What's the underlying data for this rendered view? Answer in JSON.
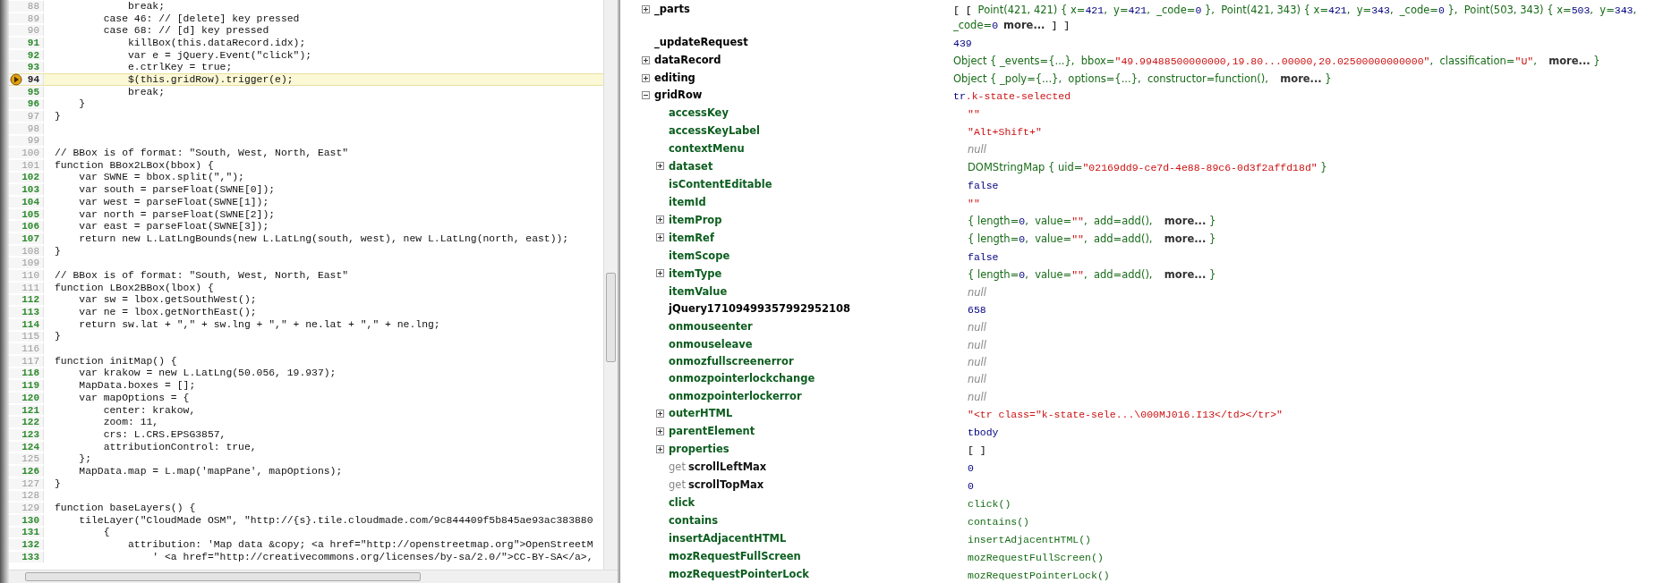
{
  "source": {
    "lines": [
      {
        "number": "88",
        "code": "            break;",
        "executable": false,
        "current": false
      },
      {
        "number": "89",
        "code": "        case 46: // [delete] key pressed",
        "executable": false,
        "current": false
      },
      {
        "number": "90",
        "code": "        case 68: // [d] key pressed",
        "executable": false,
        "current": false
      },
      {
        "number": "91",
        "code": "            killBox(this.dataRecord.idx);",
        "executable": true,
        "current": false
      },
      {
        "number": "92",
        "code": "            var e = jQuery.Event(\"click\");",
        "executable": true,
        "current": false
      },
      {
        "number": "93",
        "code": "            e.ctrlKey = true;",
        "executable": true,
        "current": false
      },
      {
        "number": "94",
        "code": "            $(this.gridRow).trigger(e);",
        "executable": true,
        "current": true
      },
      {
        "number": "95",
        "code": "            break;",
        "executable": true,
        "current": false
      },
      {
        "number": "96",
        "code": "    }",
        "executable": true,
        "current": false
      },
      {
        "number": "97",
        "code": "}",
        "executable": false,
        "current": false
      },
      {
        "number": "98",
        "executable": false,
        "current": false
      },
      {
        "number": "99",
        "executable": false,
        "current": false
      },
      {
        "number": "100",
        "code": "// BBox is of format: \"South, West, North, East\"",
        "executable": false,
        "current": false
      },
      {
        "number": "101",
        "code": "function BBox2LBox(bbox) {",
        "executable": false,
        "current": false
      },
      {
        "number": "102",
        "code": "    var SWNE = bbox.split(\",\");",
        "executable": true,
        "current": false
      },
      {
        "number": "103",
        "code": "    var south = parseFloat(SWNE[0]);",
        "executable": true,
        "current": false
      },
      {
        "number": "104",
        "code": "    var west = parseFloat(SWNE[1]);",
        "executable": true,
        "current": false
      },
      {
        "number": "105",
        "code": "    var north = parseFloat(SWNE[2]);",
        "executable": true,
        "current": false
      },
      {
        "number": "106",
        "code": "    var east = parseFloat(SWNE[3]);",
        "executable": true,
        "current": false
      },
      {
        "number": "107",
        "code": "    return new L.LatLngBounds(new L.LatLng(south, west), new L.LatLng(north, east));",
        "executable": true,
        "current": false
      },
      {
        "number": "108",
        "code": "}",
        "executable": false,
        "current": false
      },
      {
        "number": "109",
        "executable": false,
        "current": false
      },
      {
        "number": "110",
        "code": "// BBox is of format: \"South, West, North, East\"",
        "executable": false,
        "current": false
      },
      {
        "number": "111",
        "code": "function LBox2BBox(lbox) {",
        "executable": false,
        "current": false
      },
      {
        "number": "112",
        "code": "    var sw = lbox.getSouthWest();",
        "executable": true,
        "current": false
      },
      {
        "number": "113",
        "code": "    var ne = lbox.getNorthEast();",
        "executable": true,
        "current": false
      },
      {
        "number": "114",
        "code": "    return sw.lat + \",\" + sw.lng + \",\" + ne.lat + \",\" + ne.lng;",
        "executable": true,
        "current": false
      },
      {
        "number": "115",
        "code": "}",
        "executable": false,
        "current": false
      },
      {
        "number": "116",
        "executable": false,
        "current": false
      },
      {
        "number": "117",
        "code": "function initMap() {",
        "executable": false,
        "current": false
      },
      {
        "number": "118",
        "code": "    var krakow = new L.LatLng(50.056, 19.937);",
        "executable": true,
        "current": false
      },
      {
        "number": "119",
        "code": "    MapData.boxes = [];",
        "executable": true,
        "current": false
      },
      {
        "number": "120",
        "code": "    var mapOptions = {",
        "executable": true,
        "current": false
      },
      {
        "number": "121",
        "code": "        center: krakow,",
        "executable": true,
        "current": false
      },
      {
        "number": "122",
        "code": "        zoom: 11,",
        "executable": true,
        "current": false
      },
      {
        "number": "123",
        "code": "        crs: L.CRS.EPSG3857,",
        "executable": true,
        "current": false
      },
      {
        "number": "124",
        "code": "        attributionControl: true,",
        "executable": true,
        "current": false
      },
      {
        "number": "125",
        "code": "    };",
        "executable": false,
        "current": false
      },
      {
        "number": "126",
        "code": "    MapData.map = L.map('mapPane', mapOptions);",
        "executable": true,
        "current": false
      },
      {
        "number": "127",
        "code": "}",
        "executable": false,
        "current": false
      },
      {
        "number": "128",
        "executable": false,
        "current": false
      },
      {
        "number": "129",
        "code": "function baseLayers() {",
        "executable": false,
        "current": false
      },
      {
        "number": "130",
        "code": "    tileLayer(\"CloudMade OSM\", \"http://{s}.tile.cloudmade.com/9c844409f5b845ae93ac383880",
        "executable": true,
        "current": false
      },
      {
        "number": "131",
        "code": "        {",
        "executable": true,
        "current": false
      },
      {
        "number": "132",
        "code": "            attribution: 'Map data &copy; <a href=\"http://openstreetmap.org\">OpenStreetM",
        "executable": true,
        "current": false
      },
      {
        "number": "133",
        "code": "                ' <a href=\"http://creativecommons.org/licenses/by-sa/2.0/\">CC-BY-SA</a>,",
        "executable": true,
        "current": false
      }
    ]
  },
  "watch": {
    "rows": [
      {
        "name": "_parts",
        "kind": "user",
        "expanded": false,
        "value": [
          {
            "kind": "plain",
            "text": "[ [ "
          },
          {
            "kind": "obj",
            "text": "Point(421, 421) { x="
          },
          {
            "kind": "num",
            "text": "421"
          },
          {
            "kind": "obj",
            "text": ",  y="
          },
          {
            "kind": "num",
            "text": "421"
          },
          {
            "kind": "obj",
            "text": ",  _code="
          },
          {
            "kind": "num",
            "text": "0"
          },
          {
            "kind": "obj",
            "text": " },  Point(421, 343) { x="
          },
          {
            "kind": "num",
            "text": "421"
          },
          {
            "kind": "obj",
            "text": ",  y="
          },
          {
            "kind": "num",
            "text": "343"
          },
          {
            "kind": "obj",
            "text": ",  _code="
          },
          {
            "kind": "num",
            "text": "0"
          },
          {
            "kind": "obj",
            "text": " },  Point(503, 343) { x="
          },
          {
            "kind": "num",
            "text": "503"
          },
          {
            "kind": "obj",
            "text": ",  y="
          },
          {
            "kind": "num",
            "text": "343"
          },
          {
            "kind": "obj",
            "text": ",  _code="
          },
          {
            "kind": "num",
            "text": "0"
          },
          {
            "kind": "more",
            "text": "more..."
          },
          {
            "kind": "plain",
            "text": " ] ]"
          }
        ]
      },
      {
        "name": "_updateRequest",
        "kind": "user",
        "value": [
          {
            "kind": "num",
            "text": "439"
          }
        ]
      },
      {
        "name": "dataRecord",
        "kind": "user",
        "expanded": false,
        "value": [
          {
            "kind": "obj",
            "text": "Object { _events={...},  bbox="
          },
          {
            "kind": "str",
            "text": "\"49.99488500000000,19.80...00000,20.02500000000000\""
          },
          {
            "kind": "obj",
            "text": ",  classification="
          },
          {
            "kind": "str",
            "text": "\"U\""
          },
          {
            "kind": "obj",
            "text": ",  "
          },
          {
            "kind": "more",
            "text": "more..."
          },
          {
            "kind": "obj",
            "text": " }"
          }
        ]
      },
      {
        "name": "editing",
        "kind": "user",
        "expanded": false,
        "value": [
          {
            "kind": "obj",
            "text": "Object { _poly={...},  options={...},  constructor=function(),  "
          },
          {
            "kind": "more",
            "text": "more..."
          },
          {
            "kind": "obj",
            "text": " }"
          }
        ]
      },
      {
        "name": "gridRow",
        "kind": "user",
        "expanded": true,
        "value": [
          {
            "kind": "tag",
            "text": "tr"
          },
          {
            "kind": "str",
            "text": ".k-state-selected"
          }
        ],
        "children": [
          {
            "name": "accessKey",
            "kind": "dom",
            "value": [
              {
                "kind": "str",
                "text": "\"\""
              }
            ]
          },
          {
            "name": "accessKeyLabel",
            "kind": "dom",
            "value": [
              {
                "kind": "str",
                "text": "\"Alt+Shift+\""
              }
            ]
          },
          {
            "name": "contextMenu",
            "kind": "dom",
            "value": [
              {
                "kind": "null",
                "text": "null"
              }
            ]
          },
          {
            "name": "dataset",
            "kind": "dom",
            "expanded": false,
            "value": [
              {
                "kind": "obj",
                "text": "DOMStringMap { uid="
              },
              {
                "kind": "str",
                "text": "\"02169dd9-ce7d-4e88-89c6-0d3f2affd18d\""
              },
              {
                "kind": "obj",
                "text": " }"
              }
            ]
          },
          {
            "name": "isContentEditable",
            "kind": "dom",
            "value": [
              {
                "kind": "num",
                "text": "false"
              }
            ]
          },
          {
            "name": "itemId",
            "kind": "dom",
            "value": [
              {
                "kind": "str",
                "text": "\"\""
              }
            ]
          },
          {
            "name": "itemProp",
            "kind": "dom",
            "expanded": false,
            "value": [
              {
                "kind": "obj",
                "text": "{ length="
              },
              {
                "kind": "num",
                "text": "0"
              },
              {
                "kind": "obj",
                "text": ",  value="
              },
              {
                "kind": "str",
                "text": "\"\""
              },
              {
                "kind": "obj",
                "text": ",  add=add(),  "
              },
              {
                "kind": "more",
                "text": "more..."
              },
              {
                "kind": "obj",
                "text": " }"
              }
            ]
          },
          {
            "name": "itemRef",
            "kind": "dom",
            "expanded": false,
            "value": [
              {
                "kind": "obj",
                "text": "{ length="
              },
              {
                "kind": "num",
                "text": "0"
              },
              {
                "kind": "obj",
                "text": ",  value="
              },
              {
                "kind": "str",
                "text": "\"\""
              },
              {
                "kind": "obj",
                "text": ",  add=add(),  "
              },
              {
                "kind": "more",
                "text": "more..."
              },
              {
                "kind": "obj",
                "text": " }"
              }
            ]
          },
          {
            "name": "itemScope",
            "kind": "dom",
            "value": [
              {
                "kind": "num",
                "text": "false"
              }
            ]
          },
          {
            "name": "itemType",
            "kind": "dom",
            "expanded": false,
            "value": [
              {
                "kind": "obj",
                "text": "{ length="
              },
              {
                "kind": "num",
                "text": "0"
              },
              {
                "kind": "obj",
                "text": ",  value="
              },
              {
                "kind": "str",
                "text": "\"\""
              },
              {
                "kind": "obj",
                "text": ",  add=add(),  "
              },
              {
                "kind": "more",
                "text": "more..."
              },
              {
                "kind": "obj",
                "text": " }"
              }
            ]
          },
          {
            "name": "itemValue",
            "kind": "dom",
            "value": [
              {
                "kind": "null",
                "text": "null"
              }
            ]
          },
          {
            "name": "jQuery17109499357992952108",
            "kind": "user",
            "value": [
              {
                "kind": "num",
                "text": "658"
              }
            ]
          },
          {
            "name": "onmouseenter",
            "kind": "dom",
            "value": [
              {
                "kind": "null",
                "text": "null"
              }
            ]
          },
          {
            "name": "onmouseleave",
            "kind": "dom",
            "value": [
              {
                "kind": "null",
                "text": "null"
              }
            ]
          },
          {
            "name": "onmozfullscreenerror",
            "kind": "dom",
            "value": [
              {
                "kind": "null",
                "text": "null"
              }
            ]
          },
          {
            "name": "onmozpointerlockchange",
            "kind": "dom",
            "value": [
              {
                "kind": "null",
                "text": "null"
              }
            ]
          },
          {
            "name": "onmozpointerlockerror",
            "kind": "dom",
            "value": [
              {
                "kind": "null",
                "text": "null"
              }
            ]
          },
          {
            "name": "outerHTML",
            "kind": "dom",
            "expanded": false,
            "value": [
              {
                "kind": "str",
                "text": "\"<tr class=\"k-state-sele...\\000MJ016.I13</td></tr>\""
              }
            ]
          },
          {
            "name": "parentElement",
            "kind": "dom",
            "expanded": false,
            "value": [
              {
                "kind": "tag",
                "text": "tbody"
              }
            ]
          },
          {
            "name": "properties",
            "kind": "dom",
            "expanded": false,
            "value": [
              {
                "kind": "plain",
                "text": "[ ]"
              }
            ]
          },
          {
            "name": "scrollLeftMax",
            "kind": "getter",
            "prefix": "get",
            "value": [
              {
                "kind": "num",
                "text": "0"
              }
            ]
          },
          {
            "name": "scrollTopMax",
            "kind": "getter",
            "prefix": "get",
            "value": [
              {
                "kind": "num",
                "text": "0"
              }
            ]
          },
          {
            "name": "click",
            "kind": "dom",
            "value": [
              {
                "kind": "fn",
                "text": "click()"
              }
            ]
          },
          {
            "name": "contains",
            "kind": "dom",
            "value": [
              {
                "kind": "fn",
                "text": "contains()"
              }
            ]
          },
          {
            "name": "insertAdjacentHTML",
            "kind": "dom",
            "value": [
              {
                "kind": "fn",
                "text": "insertAdjacentHTML()"
              }
            ]
          },
          {
            "name": "mozRequestFullScreen",
            "kind": "dom",
            "value": [
              {
                "kind": "fn",
                "text": "mozRequestFullScreen()"
              }
            ]
          },
          {
            "name": "mozRequestPointerLock",
            "kind": "dom",
            "value": [
              {
                "kind": "fn",
                "text": "mozRequestPointerLock()"
              }
            ]
          }
        ]
      }
    ]
  }
}
